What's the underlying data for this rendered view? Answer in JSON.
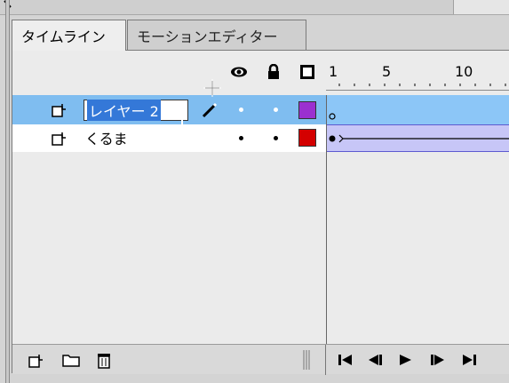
{
  "tabs": [
    {
      "label": "タイムライン",
      "active": true
    },
    {
      "label": "モーションエディター",
      "active": false
    }
  ],
  "ruler": {
    "labels": [
      "1",
      "5",
      "10"
    ]
  },
  "layers": [
    {
      "name_editing": "レイヤー 2",
      "selected": true,
      "color": "#9b30d0"
    },
    {
      "name": "くるま",
      "selected": false,
      "color": "#d40000"
    }
  ],
  "colors": {
    "selected_row": "#7fbdf0",
    "frame_selected": "#8cc6f7",
    "tween_span": "#c7c6f7"
  },
  "icons": {
    "eye": "eye-icon",
    "lock": "lock-icon",
    "outline": "outline-icon",
    "new_layer": "new-layer-icon",
    "new_folder": "new-folder-icon",
    "delete": "trash-icon"
  }
}
